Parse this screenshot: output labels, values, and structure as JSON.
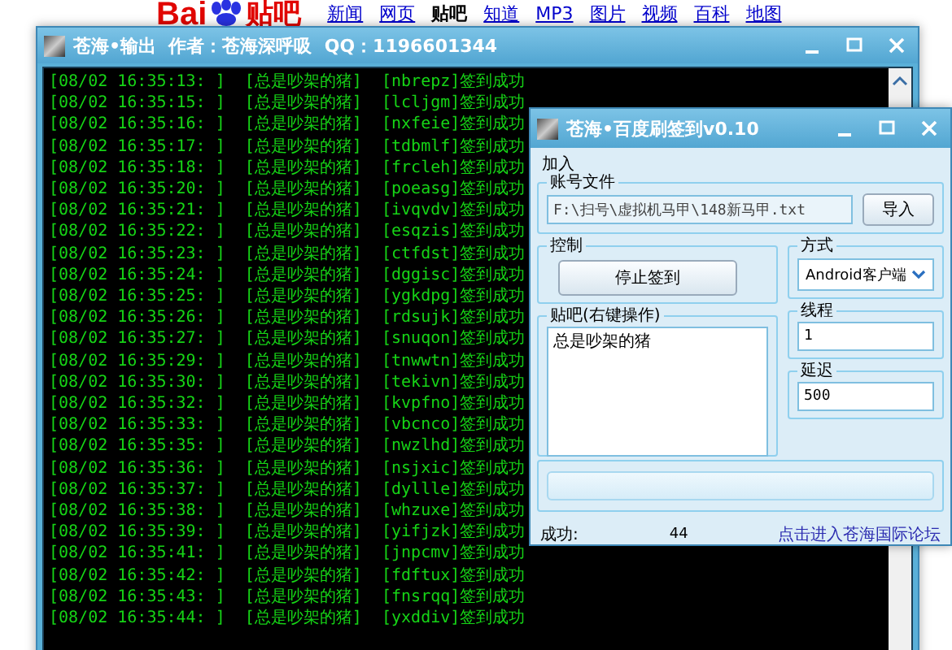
{
  "browser": {
    "logo_left": "Bai",
    "logo_right": "贴吧",
    "nav": [
      {
        "label": "新闻",
        "selected": false
      },
      {
        "label": "网页",
        "selected": false
      },
      {
        "label": "贴吧",
        "selected": true
      },
      {
        "label": "知道",
        "selected": false
      },
      {
        "label": "MP3",
        "selected": false
      },
      {
        "label": "图片",
        "selected": false
      },
      {
        "label": "视频",
        "selected": false
      },
      {
        "label": "百科",
        "selected": false
      },
      {
        "label": "地图",
        "selected": false
      }
    ]
  },
  "console": {
    "title": "苍海•输出  作者：苍海深呼吸  QQ：1196601344",
    "lines": [
      "[08/02 16:35:13: ]  [总是吵架的猪]  [nbrepz]签到成功",
      "[08/02 16:35:15: ]  [总是吵架的猪]  [lcljgm]签到成功",
      "[08/02 16:35:16: ]  [总是吵架的猪]  [nxfeie]签到成功",
      "[08/02 16:35:17: ]  [总是吵架的猪]  [tdbmlf]签到成功",
      "[08/02 16:35:18: ]  [总是吵架的猪]  [frcleh]签到成功",
      "[08/02 16:35:20: ]  [总是吵架的猪]  [poeasg]签到成功",
      "[08/02 16:35:21: ]  [总是吵架的猪]  [ivqvdv]签到成功",
      "[08/02 16:35:22: ]  [总是吵架的猪]  [esqzis]签到成功",
      "[08/02 16:35:23: ]  [总是吵架的猪]  [ctfdst]签到成功",
      "[08/02 16:35:24: ]  [总是吵架的猪]  [dggisc]签到成功",
      "[08/02 16:35:25: ]  [总是吵架的猪]  [ygkdpg]签到成功",
      "[08/02 16:35:26: ]  [总是吵架的猪]  [rdsujk]签到成功",
      "[08/02 16:35:27: ]  [总是吵架的猪]  [snuqon]签到成功",
      "[08/02 16:35:29: ]  [总是吵架的猪]  [tnwwtn]签到成功",
      "[08/02 16:35:30: ]  [总是吵架的猪]  [tekivn]签到成功",
      "[08/02 16:35:32: ]  [总是吵架的猪]  [kvpfno]签到成功",
      "[08/02 16:35:33: ]  [总是吵架的猪]  [vbcnco]签到成功",
      "[08/02 16:35:35: ]  [总是吵架的猪]  [nwzlhd]签到成功",
      "[08/02 16:35:36: ]  [总是吵架的猪]  [nsjxic]签到成功",
      "[08/02 16:35:37: ]  [总是吵架的猪]  [dyllle]签到成功",
      "[08/02 16:35:38: ]  [总是吵架的猪]  [whzuxe]签到成功",
      "[08/02 16:35:39: ]  [总是吵架的猪]  [yifjzk]签到成功",
      "[08/02 16:35:41: ]  [总是吵架的猪]  [jnpcmv]签到成功",
      "[08/02 16:35:42: ]  [总是吵架的猪]  [fdftux]签到成功",
      "[08/02 16:35:43: ]  [总是吵架的猪]  [fnsrqq]签到成功",
      "[08/02 16:35:44: ]  [总是吵架的猪]  [yxddiv]签到成功"
    ]
  },
  "dialog": {
    "title": "苍海•百度刷签到v0.10",
    "menu": "加入",
    "account_file": {
      "legend": "账号文件",
      "value": "F:\\扫号\\虚拟机马甲\\148新马甲.txt",
      "button": "导入"
    },
    "control": {
      "legend": "控制",
      "button": "停止签到"
    },
    "mode": {
      "legend": "方式",
      "value": "Android客户端"
    },
    "tieba": {
      "legend": "贴吧(右键操作)",
      "items": [
        "总是吵架的猪"
      ]
    },
    "threads": {
      "legend": "线程",
      "value": "1"
    },
    "delay": {
      "legend": "延迟",
      "value": "500"
    },
    "progress": {
      "level": 0
    },
    "success_label": "成功:",
    "success_count": "44",
    "forum_link": "点击进入苍海国际论坛"
  }
}
